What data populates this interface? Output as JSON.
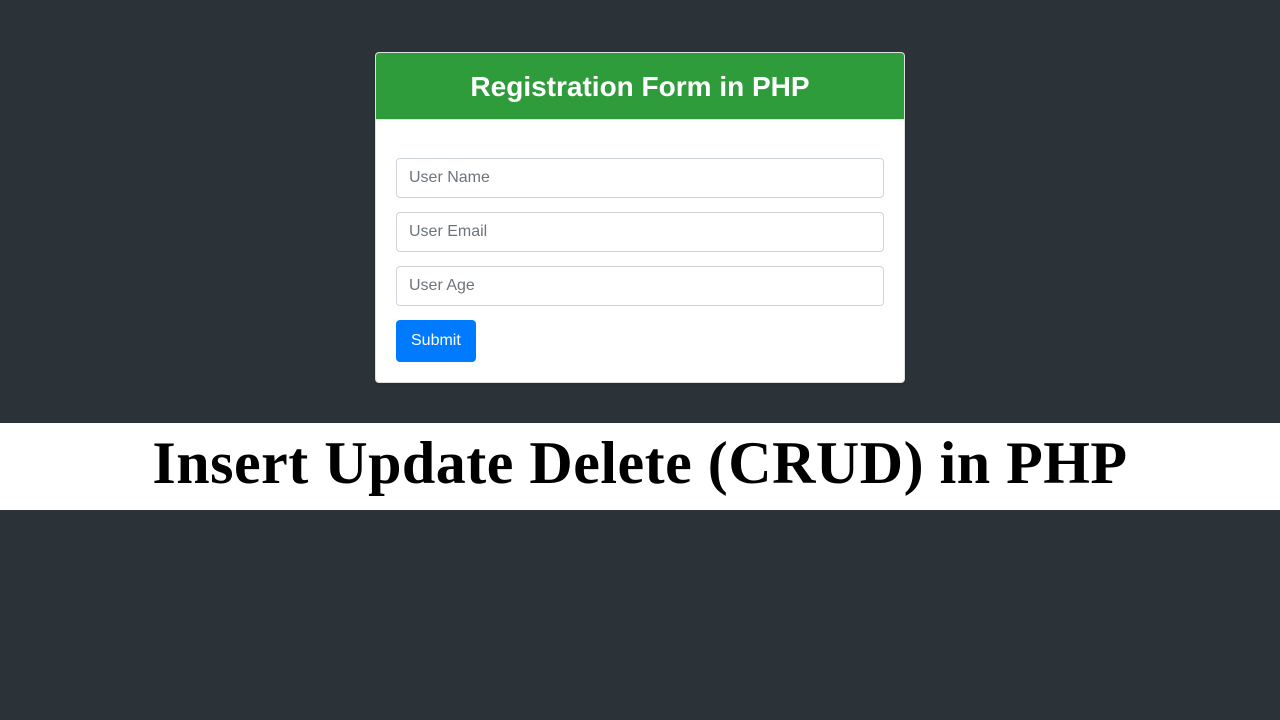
{
  "card": {
    "title": "Registration Form in PHP",
    "fields": {
      "username": {
        "placeholder": "User Name",
        "value": ""
      },
      "email": {
        "placeholder": "User Email",
        "value": ""
      },
      "age": {
        "placeholder": "User Age",
        "value": ""
      }
    },
    "submit_label": "Submit"
  },
  "banner": {
    "heading": "Insert Update Delete (CRUD) in PHP"
  }
}
